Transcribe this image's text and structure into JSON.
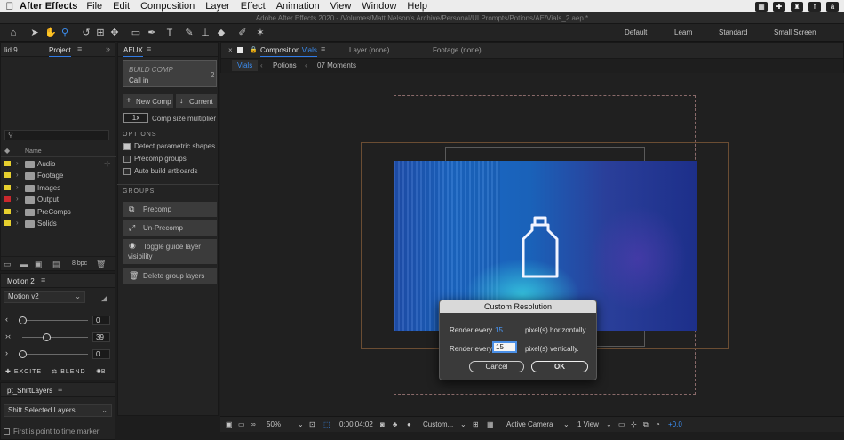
{
  "menubar": {
    "apple": "",
    "app": "After Effects",
    "items": [
      "File",
      "Edit",
      "Composition",
      "Layer",
      "Effect",
      "Animation",
      "View",
      "Window",
      "Help"
    ],
    "right_icons": [
      "grid-icon",
      "plus-icon",
      "shirt-icon",
      "font-icon",
      "amazon-icon"
    ]
  },
  "titlebar": {
    "text": "Adobe After Effects 2020 - /Volumes/Matt Nelson's Archive/Personal/UI Prompts/Potions/AE/Vials_2.aep *"
  },
  "toolbar": {
    "workspaces": [
      "Default",
      "Learn",
      "Standard",
      "Small Screen"
    ]
  },
  "left_strip": {
    "tab": "lid 9"
  },
  "project": {
    "tab": "Project",
    "search_placeholder": "",
    "col_name": "Name",
    "items": [
      {
        "name": "Audio",
        "label_color": "#e6cf2e"
      },
      {
        "name": "Footage",
        "label_color": "#e6cf2e"
      },
      {
        "name": "Images",
        "label_color": "#e6cf2e"
      },
      {
        "name": "Output",
        "label_color": "#c9282d"
      },
      {
        "name": "PreComps",
        "label_color": "#e6cf2e"
      },
      {
        "name": "Solids",
        "label_color": "#e6cf2e"
      }
    ],
    "bpc": "8 bpc"
  },
  "aeux": {
    "tab": "AEUX",
    "build_title": "BUILD COMP",
    "build_sub": "Call in",
    "build_num": "2",
    "new_comp": "New Comp",
    "current": "Current",
    "scale": "1x",
    "comp_size": "Comp size multiplier",
    "options_title": "OPTIONS",
    "options": [
      {
        "label": "Detect parametric shapes",
        "checked": true
      },
      {
        "label": "Precomp groups",
        "checked": false
      },
      {
        "label": "Auto build artboards",
        "checked": false
      }
    ],
    "groups_title": "GROUPS",
    "buttons": [
      "Precomp",
      "Un-Precomp",
      "Toggle guide layer visibility",
      "Delete group layers"
    ]
  },
  "composition": {
    "close": "×",
    "tab_prefix": "Composition",
    "tab_name": "Vials",
    "layer_tab": "Layer (none)",
    "footage_tab": "Footage (none)",
    "crumbs": [
      "Vials",
      "Potions",
      "07 Moments"
    ]
  },
  "dialog": {
    "title": "Custom Resolution",
    "render_every": "Render every",
    "h_value": "15",
    "h_suffix": "pixel(s) horizontally.",
    "v_value": "15",
    "v_suffix": "pixel(s) vertically.",
    "cancel": "Cancel",
    "ok": "OK"
  },
  "viewer_bar": {
    "zoom": "50%",
    "timecode": "0:00:04:02",
    "resolution": "Custom...",
    "camera": "Active Camera",
    "views": "1 View",
    "exposure": "+0.0"
  },
  "motion": {
    "tab": "Motion 2",
    "preset": "Motion v2",
    "sliders": [
      {
        "icon": "‹",
        "value": "0",
        "level": 0.0
      },
      {
        "icon": "›‹",
        "value": "39",
        "level": 0.39
      },
      {
        "icon": "›",
        "value": "0",
        "level": 0.0
      }
    ],
    "excite": "EXCITE",
    "blend": "BLEND",
    "burst": "B"
  },
  "shift": {
    "tab": "pt_ShiftLayers",
    "dropdown": "Shift Selected Layers",
    "hint": "First is point to time marker"
  }
}
